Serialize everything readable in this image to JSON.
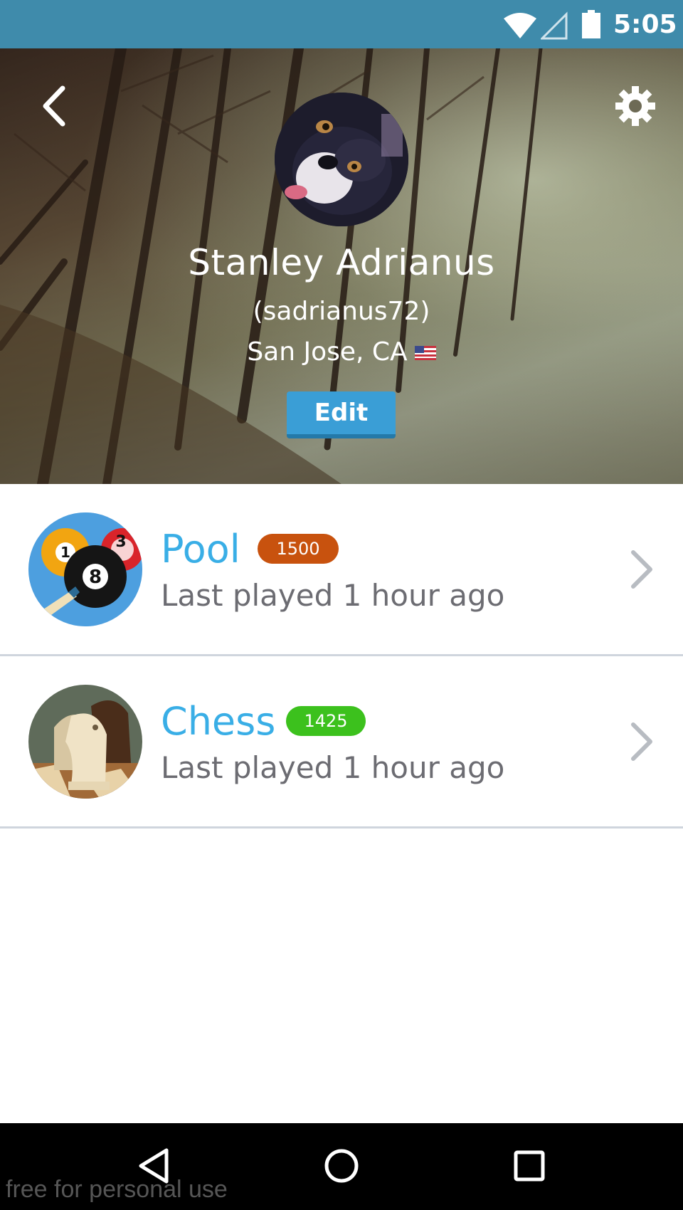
{
  "status_bar": {
    "time": "5:05"
  },
  "profile": {
    "name": "Stanley Adrianus",
    "username": "(sadrianus72)",
    "location": "San Jose, CA",
    "edit_label": "Edit"
  },
  "games": [
    {
      "title": "Pool",
      "rating": "1500",
      "rating_color": "#c8520e",
      "last_played": "Last played 1 hour ago",
      "icon": "pool-icon"
    },
    {
      "title": "Chess",
      "rating": "1425",
      "rating_color": "#3cc11d",
      "last_played": "Last played 1 hour ago",
      "icon": "chess-icon"
    }
  ],
  "watermark": "free for personal use",
  "colors": {
    "status_bar": "#3f8bab",
    "accent": "#39aee6",
    "edit_button": "#3a9ed6"
  }
}
